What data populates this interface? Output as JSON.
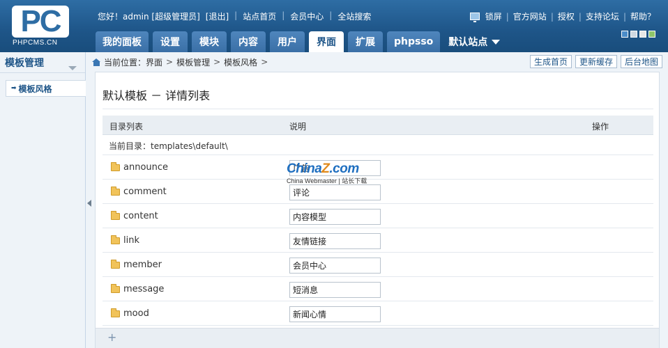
{
  "brand": {
    "logo_text": "PC",
    "logo_sub": "PHPCMS.CN"
  },
  "topbar": {
    "greeting": "您好！admin [超级管理员]",
    "logout": "[退出]",
    "site_home": "站点首页",
    "member_center": "会员中心",
    "site_search": "全站搜索"
  },
  "toplinks": {
    "lock": "锁屏",
    "official": "官方网站",
    "license": "授权",
    "forum": "支持论坛",
    "help": "帮助？"
  },
  "skins": [
    "#4a8cc9",
    "#cfd8e1",
    "#e6e6e6",
    "#8fc56b"
  ],
  "tabs": [
    {
      "label": "我的面板"
    },
    {
      "label": "设置"
    },
    {
      "label": "模块"
    },
    {
      "label": "内容"
    },
    {
      "label": "用户"
    },
    {
      "label": "界面",
      "active": true
    },
    {
      "label": "扩展"
    },
    {
      "label": "phpsso"
    }
  ],
  "site_select": {
    "label": "默认站点"
  },
  "sidebar": {
    "title": "模板管理",
    "items": [
      {
        "label": "模板风格"
      }
    ]
  },
  "breadcrumb": {
    "prefix": "当前位置：",
    "items": [
      "界面",
      "模板管理",
      "模板风格"
    ],
    "sep": ">"
  },
  "actions": {
    "gen_home": "生成首页",
    "update_cache": "更新缓存",
    "sitemap": "后台地图"
  },
  "page": {
    "title": "默认模板 － 详情列表",
    "columns": [
      "目录列表",
      "说明",
      "操作"
    ],
    "current_dir": "当前目录：templates\\default\\",
    "rows": [
      {
        "name": "announce",
        "desc": "广告"
      },
      {
        "name": "comment",
        "desc": "评论"
      },
      {
        "name": "content",
        "desc": "内容模型"
      },
      {
        "name": "link",
        "desc": "友情链接"
      },
      {
        "name": "member",
        "desc": "会员中心"
      },
      {
        "name": "message",
        "desc": "短消息"
      },
      {
        "name": "mood",
        "desc": "新闻心情"
      }
    ],
    "add_symbol": "+"
  },
  "watermark": {
    "brand_a": "China",
    "brand_z": "Z",
    "brand_b": ".com",
    "sub": "China Webmaster | 站长下载"
  }
}
